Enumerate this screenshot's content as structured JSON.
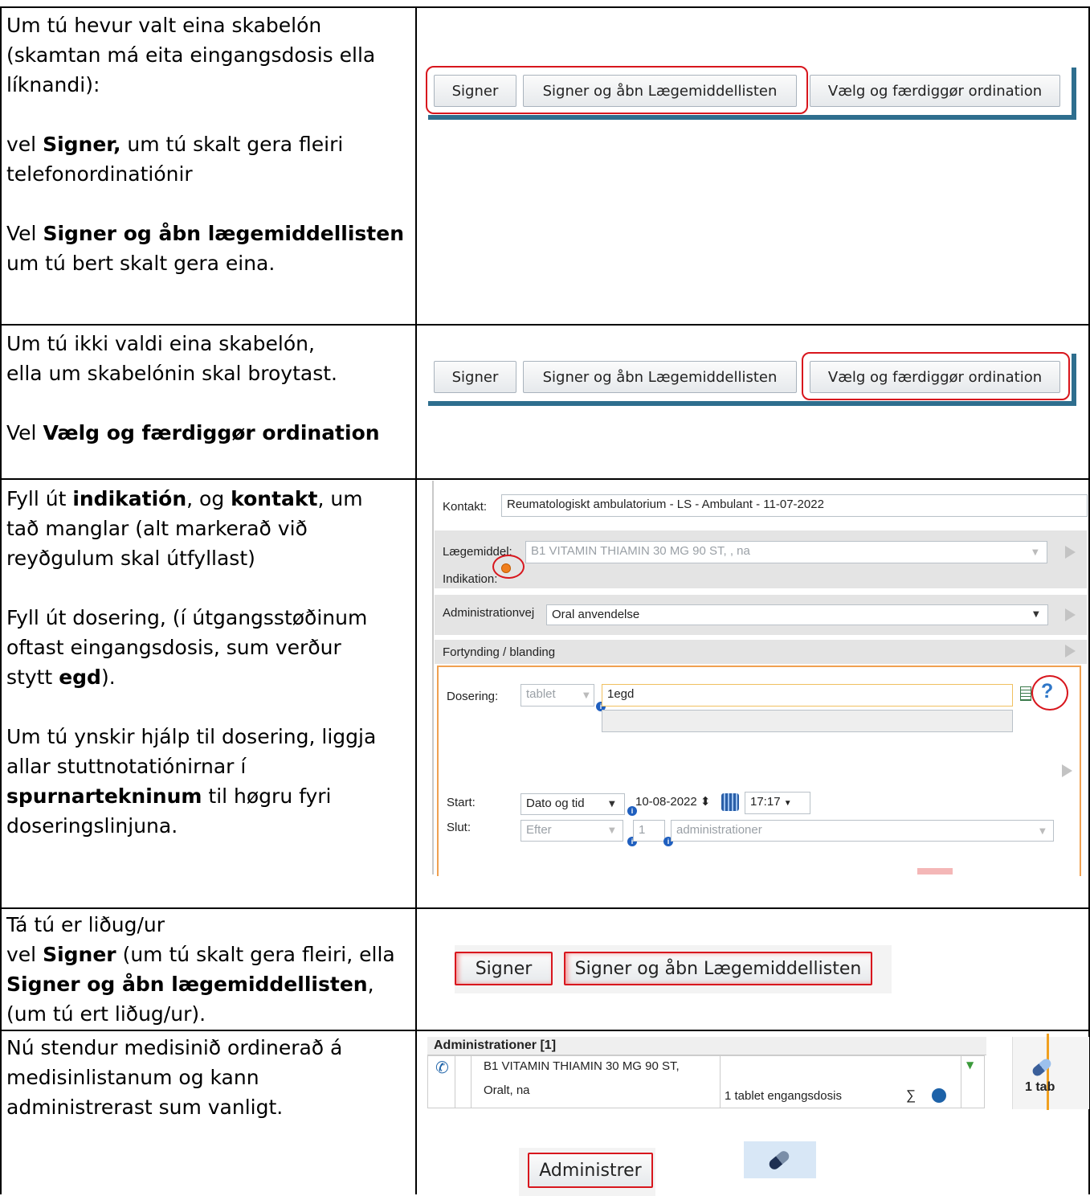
{
  "rows": [
    {
      "lines": [
        {
          "text": "Um tú hevur valt eina skabelón"
        },
        {
          "text": "(skamtan má eita eingangsdosis ella"
        },
        {
          "text": "líknandi):"
        },
        {
          "gap": true
        },
        {
          "pre": "vel ",
          "bold": "Signer,",
          "post": " um tú skalt gera fleiri"
        },
        {
          "text": "telefonordinatiónir"
        },
        {
          "gap": true
        },
        {
          "pre": "Vel ",
          "bold": "Signer og åbn lægemiddellisten",
          "post": ""
        },
        {
          "text": "um tú bert skalt gera eina."
        }
      ]
    },
    {
      "lines": [
        {
          "text": "Um tú ikki valdi eina skabelón,"
        },
        {
          "text": "ella um skabelónin skal broytast."
        },
        {
          "gap": true
        },
        {
          "pre": "Vel ",
          "bold": "Vælg og færdiggør ordination",
          "post": ""
        }
      ]
    },
    {
      "lines": [
        {
          "pre": "Fyll út ",
          "bold": "indikatión",
          "post": ", og ",
          "bold2": "kontakt",
          "post2": ", um"
        },
        {
          "text": "tað manglar (alt markerað við"
        },
        {
          "text": "reyðgulum skal útfyllast)"
        },
        {
          "gap": true
        },
        {
          "text": "Fyll út dosering, (í útgangsstøðinum"
        },
        {
          "text": "oftast eingangsdosis, sum verður"
        },
        {
          "pre": "stytt ",
          "bold": "egd",
          "post": ")."
        },
        {
          "gap": true
        },
        {
          "text": "Um tú ynskir hjálp til dosering, liggja"
        },
        {
          "text": "allar stuttnotatiónirnar í"
        },
        {
          "pre": "",
          "bold": "spurnartekninum",
          "post": " til høgru fyri"
        },
        {
          "text": "doseringslinjuna."
        }
      ]
    },
    {
      "lines": [
        {
          "text": "Tá tú er liðug/ur"
        },
        {
          "pre": "vel ",
          "bold": "Signer",
          "post": " (um tú skalt gera fleiri, ella"
        },
        {
          "pre": "",
          "bold": "Signer og åbn lægemiddellisten",
          "post": ","
        },
        {
          "text": "(um tú ert liðug/ur)."
        }
      ]
    },
    {
      "lines": [
        {
          "text": "Nú stendur medisinið ordinerað á"
        },
        {
          "text": "medisinlistanum og kann"
        },
        {
          "text": "administrerast sum vanligt."
        }
      ]
    }
  ],
  "buttons": {
    "signer": "Signer",
    "signer_open": "Signer og åbn Lægemiddellisten",
    "choose": "Vælg og færdiggør ordination",
    "administrer": "Administrer"
  },
  "form": {
    "kontakt_label": "Kontakt:",
    "kontakt_value": "Reumatologiskt ambulatorium - LS - Ambulant -  11-07-2022",
    "laegemiddel_label": "Lægemiddel:",
    "laegemiddel_value": "B1 VITAMIN THIAMIN 30 MG 90 ST, , na",
    "indikation_label": "Indikation:",
    "adm_label": "Administrationvej",
    "adm_value": "Oral anvendelse",
    "fortynding_label": "Fortynding / blanding",
    "dosering_label": "Dosering:",
    "unit_value": "tablet",
    "dose_value": "1egd",
    "help_glyph": "?",
    "start_label": "Start:",
    "start_type": "Dato og tid",
    "start_date": "10-08-2022",
    "start_time": "17:17",
    "slut_label": "Slut:",
    "slut_type": "Efter",
    "slut_count": "1",
    "slut_unit": "administrationer"
  },
  "adm_list": {
    "header": "Administrationer [1]",
    "drug_line1": "B1 VITAMIN THIAMIN 30 MG 90 ST,",
    "drug_line2": "Oralt, na",
    "dose_text": "1 tablet  engangsdosis",
    "sum_glyph": "∑",
    "side_text": "1 tab"
  },
  "colors": {
    "highlight": "#d8161d",
    "panel_blue": "#2e6e8e",
    "orange": "#f0a050"
  }
}
